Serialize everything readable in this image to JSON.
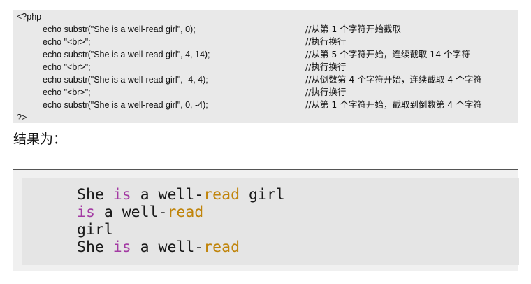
{
  "code": {
    "open_tag": "<?php",
    "close_tag": "?>",
    "lines": [
      {
        "stmt": "echo substr(\"She is a well-read girl\", 0);",
        "comment": "//从第 1 个字符开始截取"
      },
      {
        "stmt": "echo \"<br>\";",
        "comment": "//执行换行"
      },
      {
        "stmt": "echo substr(\"She is a well-read girl\", 4, 14);",
        "comment": "//从第 5 个字符开始，连续截取 14 个字符"
      },
      {
        "stmt": "echo \"<br>\";",
        "comment": "//执行换行"
      },
      {
        "stmt": "echo substr(\"She is a well-read girl\", -4, 4);",
        "comment": "//从倒数第 4 个字符开始，连续截取 4 个字符"
      },
      {
        "stmt": "echo \"<br>\";",
        "comment": "//执行换行"
      },
      {
        "stmt": "echo substr(\"She is a well-read girl\", 0, -4);",
        "comment": "//从第 1 个字符开始，截取到倒数第 4 个字符"
      }
    ]
  },
  "result_label": "结果为：",
  "output": {
    "line1": {
      "a": "She ",
      "b": "is",
      "c": " a well-",
      "d": "read",
      "e": " girl"
    },
    "line2": {
      "a": "is",
      "b": " a well-",
      "c": "read"
    },
    "line3": {
      "a": "girl"
    },
    "line4": {
      "a": "She ",
      "b": "is",
      "c": " a well-",
      "d": "read"
    }
  },
  "colors": {
    "keyword_is": "#a33aa3",
    "keyword_read": "#c0840a"
  }
}
